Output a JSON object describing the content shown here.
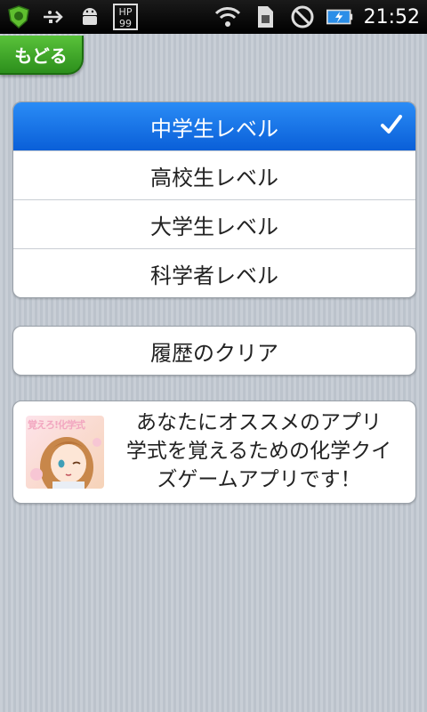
{
  "statusbar": {
    "time": "21:52",
    "left_icons": [
      "shield-icon",
      "usb-icon",
      "android-icon",
      "hp-widget-icon"
    ],
    "right_icons": [
      "wifi-icon",
      "sim-icon",
      "no-signal-icon",
      "battery-icon"
    ],
    "hp_text": "HP 99"
  },
  "back": {
    "label": "もどる"
  },
  "levels": {
    "items": [
      {
        "label": "中学生レベル",
        "selected": true
      },
      {
        "label": "高校生レベル",
        "selected": false
      },
      {
        "label": "大学生レベル",
        "selected": false
      },
      {
        "label": "科学者レベル",
        "selected": false
      }
    ]
  },
  "clear": {
    "label": "履歴のクリア"
  },
  "ad": {
    "line1": "あなたにオススメのアプリ",
    "line2": "学式を覚えるための化学クイ",
    "line3": "ズゲームアプリです！",
    "thumb_title": "覚えろ!化学式"
  },
  "colors": {
    "accent": "#0a6ae0",
    "back_green": "#3aa52a"
  }
}
